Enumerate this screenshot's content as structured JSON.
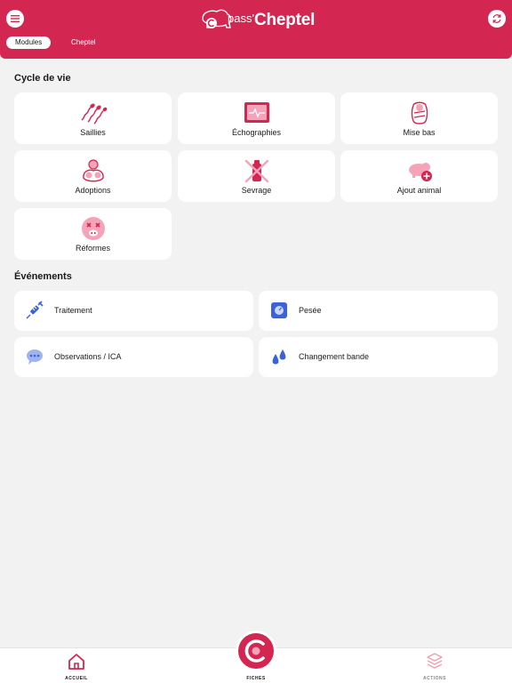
{
  "header": {
    "logo_prefix": "pass'",
    "logo_brand": "Cheptel",
    "tabs": [
      {
        "label": "Modules",
        "active": true
      },
      {
        "label": "Cheptel",
        "active": false
      }
    ],
    "menu_icon": "hamburger-menu-icon",
    "sync_icon": "sync-icon"
  },
  "cycle_de_vie": {
    "title": "Cycle de vie",
    "items": [
      {
        "label": "Saillies",
        "icon": "sperm-icon"
      },
      {
        "label": "Échographies",
        "icon": "ultrasound-screen-icon"
      },
      {
        "label": "Mise bas",
        "icon": "swaddled-piglet-icon"
      },
      {
        "label": "Adoptions",
        "icon": "piglets-group-icon"
      },
      {
        "label": "Sevrage",
        "icon": "bottle-crossed-icon"
      },
      {
        "label": "Ajout animal",
        "icon": "pig-add-icon"
      },
      {
        "label": "Réformes",
        "icon": "dead-pig-icon"
      }
    ]
  },
  "evenements": {
    "title": "Événements",
    "items": [
      {
        "label": "Traitement",
        "icon": "syringe-icon"
      },
      {
        "label": "Pesée",
        "icon": "scale-icon"
      },
      {
        "label": "Observations / ICA",
        "icon": "chat-bubble-icon"
      },
      {
        "label": "Changement bande",
        "icon": "drops-icon"
      }
    ]
  },
  "bottom_nav": {
    "home_label": "ACCUEIL",
    "fiches_label": "FICHES",
    "actions_label": "ACTIONS"
  },
  "colors": {
    "brand": "#d32650",
    "pink_light": "#f5a3b8",
    "blue_icon": "#3a63d9",
    "actions_inactive": "#f0a0b4"
  }
}
